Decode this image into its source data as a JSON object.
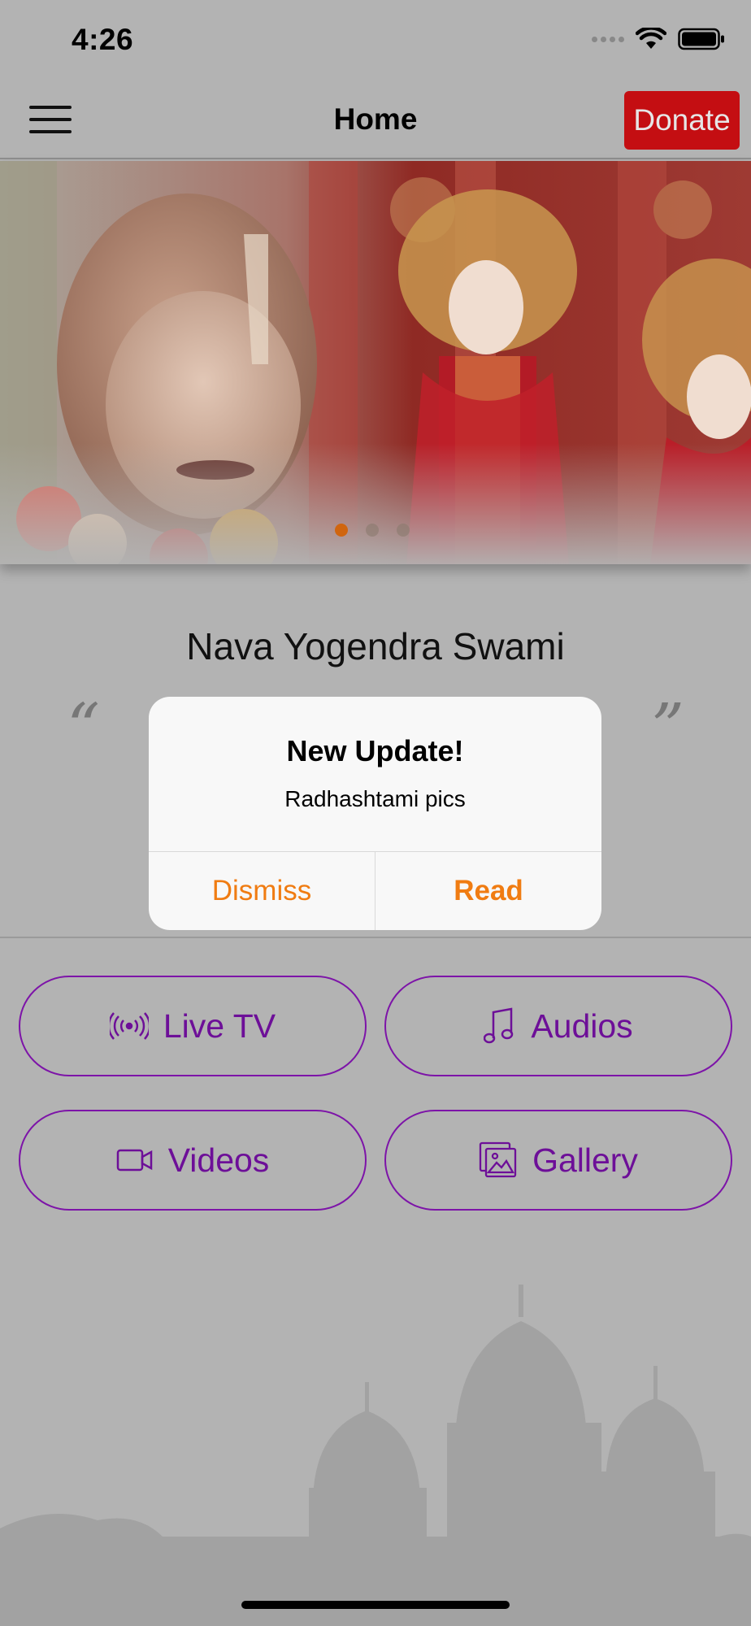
{
  "status_bar": {
    "time": "4:26"
  },
  "nav": {
    "title": "Home",
    "donate_label": "Donate"
  },
  "banner": {
    "description_icon": "photo-banner",
    "active_index": 0,
    "dot_count": 3
  },
  "profile": {
    "name": "Nava Yogendra Swami",
    "quote_open": "“",
    "quote_close": "”"
  },
  "actions": [
    {
      "label": "Live TV",
      "icon": "broadcast-icon"
    },
    {
      "label": "Audios",
      "icon": "music-note-icon"
    },
    {
      "label": "Videos",
      "icon": "video-camera-icon"
    },
    {
      "label": "Gallery",
      "icon": "photos-icon"
    }
  ],
  "dialog": {
    "title": "New Update!",
    "message": "Radhashtami pics",
    "dismiss_label": "Dismiss",
    "read_label": "Read"
  },
  "colors": {
    "accent_purple": "#7d14a8",
    "donate_red": "#c40e12",
    "dialog_orange": "#f07c12",
    "carousel_active": "#d0650f"
  }
}
